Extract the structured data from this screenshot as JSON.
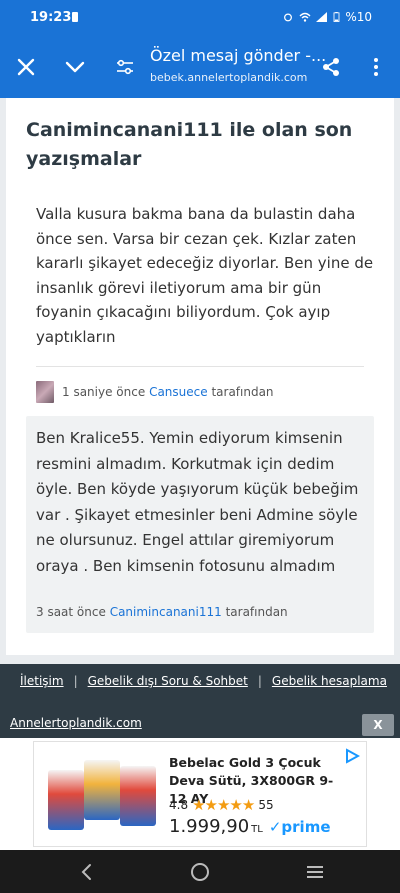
{
  "status": {
    "time": "19:23",
    "battery": "%10"
  },
  "appbar": {
    "title": "Özel mesaj gönder -...",
    "url": "bebek.annelertoplandik.com"
  },
  "page": {
    "heading": "Canimincanani111 ile olan son yazışmalar",
    "messages": [
      {
        "text": "Valla kusura bakma bana da bulastin daha önce sen. Varsa bir cezan çek. Kızlar zaten kararlı şikayet edeceğiz diyorlar. Ben yine de insanlık görevi iletiyorum ama bir gün foyanin çıkacağını biliyordum. Çok ayıp yaptıkların",
        "time": "1 saniye önce",
        "author": "Cansuece",
        "suffix": "tarafından"
      },
      {
        "text": "Ben Kralice55. Yemin ediyorum kimsenin resmini almadım. Korkutmak için dedim öyle. Ben köyde yaşıyorum küçük bebeğim var . Şikayet etmesinler beni Admine söyle ne olursunuz. Engel attılar giremiyorum oraya . Ben kimsenin fotosunu almadım",
        "time": "3 saat önce",
        "author": "Canimincanani111",
        "suffix": "tarafından"
      }
    ]
  },
  "footer": {
    "links": [
      "İletişim",
      "Gebelik dışı Soru & Sohbet",
      "Gebelik hesaplama"
    ],
    "site": "Annelertoplandik.com",
    "close": "X"
  },
  "ad": {
    "title": "Bebelac Gold 3 Çocuk Deva Sütü, 3X800GR 9-12 AY",
    "rating": "4.8",
    "reviews": "55",
    "price": "1.999,90",
    "currency": "TL",
    "prime": "✓prime",
    "product_label": "bebelac"
  },
  "colors": {
    "brand": "#1a73d6",
    "footer": "#2e3b44",
    "link": "#1a73d6"
  }
}
